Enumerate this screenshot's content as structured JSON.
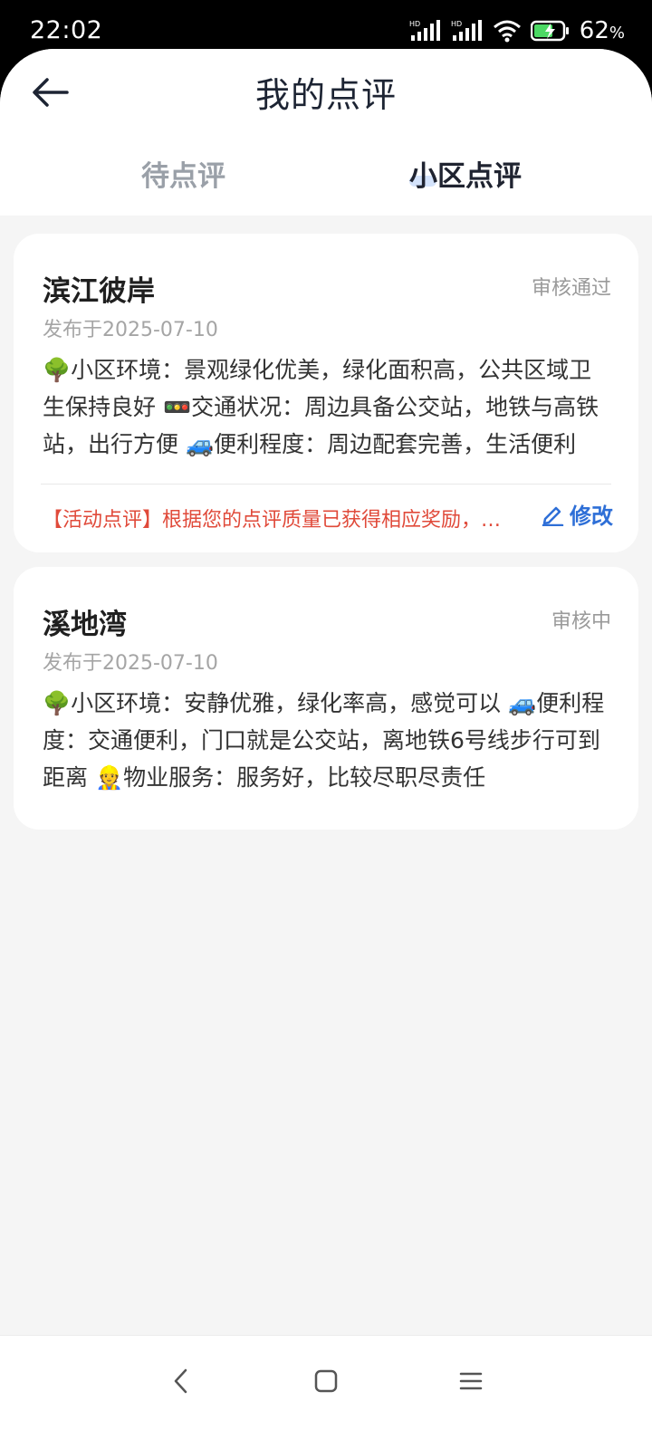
{
  "status_bar": {
    "time": "22:02",
    "battery_percent": "62",
    "battery_unit": "%",
    "signal_label_1": "HD",
    "signal_label_2": "HD"
  },
  "header": {
    "title": "我的点评",
    "back_icon": "arrow-left-icon"
  },
  "tabs": [
    {
      "label": "待点评",
      "active": false
    },
    {
      "label": "小区点评",
      "active": true
    }
  ],
  "reviews": [
    {
      "name": "滨江彼岸",
      "status": "审核通过",
      "date": "发布于2025-07-10",
      "content": "🌳小区环境：景观绿化优美，绿化面积高，公共区域卫生保持良好 🚥交通状况：周边具备公交站，地铁与高铁站，出行方便 🚙便利程度：周边配套完善，生活便利",
      "reward_text": "【活动点评】根据您的点评质量已获得相应奖励，感谢您的参与",
      "edit_label": "修改"
    },
    {
      "name": "溪地湾",
      "status": "审核中",
      "date": "发布于2025-07-10",
      "content": "🌳小区环境：安静优雅，绿化率高，感觉可以 🚙便利程度：交通便利，门口就是公交站，离地铁6号线步行可到距离 👷物业服务：服务好，比较尽职尽责任"
    }
  ],
  "colors": {
    "accent": "#2e6fd7",
    "reward": "#e04a3a",
    "background": "#f5f5f5"
  },
  "nav_bar": {
    "icons": [
      "back-chevron-icon",
      "home-square-icon",
      "menu-lines-icon"
    ]
  }
}
